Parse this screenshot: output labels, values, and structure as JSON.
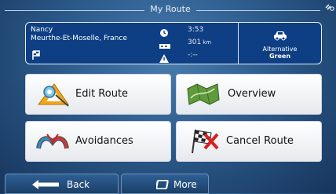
{
  "header": {
    "title": "My Route",
    "gps_icon": "gps-satellite-icon"
  },
  "route": {
    "destination_line1": "Nancy",
    "destination_line2": "Meurthe-Et-Moselle, France",
    "time": "3:53",
    "distance_value": "301",
    "distance_unit": "km",
    "warnings": "-:--",
    "alternative_label": "Alternative",
    "alternative_mode": "Green"
  },
  "menu": {
    "edit_route": "Edit Route",
    "overview": "Overview",
    "avoidances": "Avoidances",
    "cancel_route": "Cancel Route"
  },
  "bottom": {
    "back": "Back",
    "more": "More"
  },
  "colors": {
    "panel_bg": "#0e3e83",
    "tile_bg": "#f2f3f5",
    "screen_bg": "#2c5b8c"
  }
}
